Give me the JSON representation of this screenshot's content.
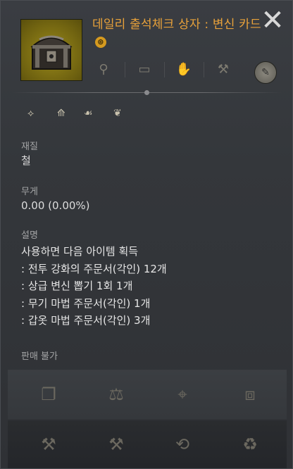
{
  "item": {
    "title": "데일리 출석체크 상자 : 변신 카드",
    "badge": "⊛"
  },
  "header_icons": [
    {
      "name": "money-bag-icon",
      "glyph": "⚲"
    },
    {
      "name": "storage-box-icon",
      "glyph": "▭"
    },
    {
      "name": "hand-icon",
      "glyph": "✋"
    },
    {
      "name": "anvil-icon",
      "glyph": "⚒"
    }
  ],
  "chat_icon": "✎",
  "close_icon": "✕",
  "class_icons": [
    "⟡",
    "⟰",
    "☙",
    "❦"
  ],
  "material": {
    "label": "재질",
    "value": "철"
  },
  "weight": {
    "label": "무게",
    "value": "0.00 (0.00%)"
  },
  "description": {
    "label": "설명",
    "lines": [
      "사용하면 다음 아이템 획득",
      ": 전투 강화의 주문서(각인) 12개",
      ": 상급 변신 뽑기 1회 1개",
      ": 무기 마법 주문서(각인) 1개",
      ": 갑옷 마법 주문서(각인) 3개"
    ]
  },
  "sell_status": "판매 불가",
  "actions_row1": [
    {
      "name": "book-icon",
      "glyph": "❐"
    },
    {
      "name": "scales-icon",
      "glyph": "⚖"
    },
    {
      "name": "map-icon",
      "glyph": "⌖"
    },
    {
      "name": "treasure-chest-icon",
      "glyph": "⧈"
    }
  ],
  "actions_row2": [
    {
      "name": "anvil-icon",
      "glyph": "⚒"
    },
    {
      "name": "hammer-icon",
      "glyph": "⚒"
    },
    {
      "name": "magnifier-cycle-icon",
      "glyph": "⟲"
    },
    {
      "name": "trash-can-icon",
      "glyph": "♻"
    }
  ]
}
